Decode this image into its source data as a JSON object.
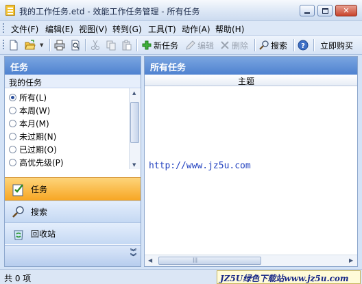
{
  "window": {
    "title": "我的工作任务.etd - 效能工作任务管理 - 所有任务"
  },
  "menu": {
    "items": [
      "文件(F)",
      "编辑(E)",
      "视图(V)",
      "转到(G)",
      "工具(T)",
      "动作(A)",
      "帮助(H)"
    ]
  },
  "toolbar": {
    "new_task": "新任务",
    "edit": "编辑",
    "delete": "删除",
    "search": "搜索",
    "buy_now": "立即购买"
  },
  "left_panel": {
    "header": "任务",
    "section_title": "我的任务",
    "filters": [
      "所有(L)",
      "本周(W)",
      "本月(M)",
      "未过期(N)",
      "已过期(O)",
      "高优先级(P)"
    ],
    "selected_filter": 0,
    "nav": {
      "tasks": "任务",
      "search": "搜索",
      "recycle": "回收站"
    }
  },
  "right_panel": {
    "header": "所有任务",
    "column_subject": "主题",
    "url": "http://www.jz5u.com"
  },
  "status": {
    "count_text": "共 0 项",
    "watermark": "JZ5U绿色下载站www.jz5u.com"
  },
  "colors": {
    "panel_header": "#5a8ad4",
    "active_tab": "#f7b23b",
    "link": "#1f3fbf"
  }
}
